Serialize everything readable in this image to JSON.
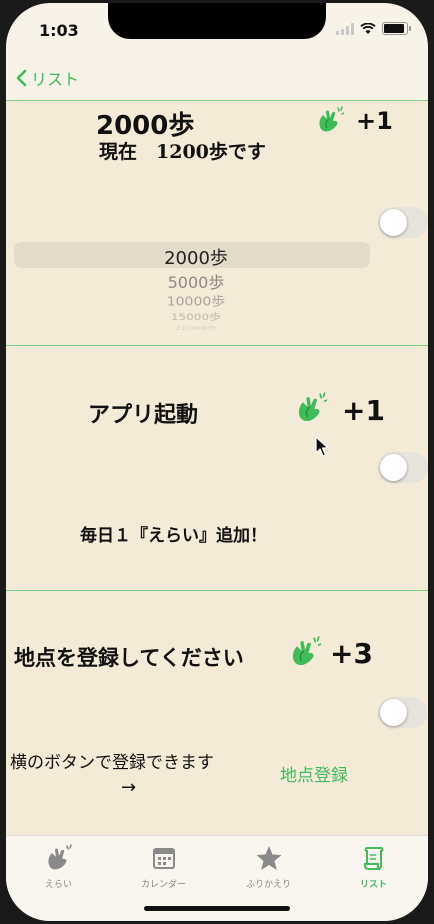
{
  "status": {
    "time": "1:03"
  },
  "nav": {
    "back_label": "リスト"
  },
  "cells": {
    "steps": {
      "title": "2000歩",
      "plus": "+1",
      "current": "現在　1200歩です",
      "picker": [
        "2000歩",
        "5000歩",
        "10000歩",
        "15000歩",
        "20000歩"
      ],
      "toggle_on": false
    },
    "app": {
      "title": "アプリ起動",
      "plus": "+1",
      "note": "毎日１『えらい』追加！",
      "toggle_on": false
    },
    "place": {
      "title": "地点を登録してください",
      "plus": "+3",
      "hint": "横のボタンで登録できます",
      "arrow": "→",
      "register_button": "地点登録",
      "toggle_on": false
    }
  },
  "tabs": [
    {
      "label": "えらい",
      "icon": "clap-icon",
      "active": false
    },
    {
      "label": "カレンダー",
      "icon": "calendar-icon",
      "active": false
    },
    {
      "label": "ふりかえり",
      "icon": "star-icon",
      "active": false
    },
    {
      "label": "リスト",
      "icon": "list-icon",
      "active": true
    }
  ],
  "colors": {
    "accent": "#3ebc58",
    "cell_bg": "#f4ead8",
    "separator": "#7ed08a"
  }
}
